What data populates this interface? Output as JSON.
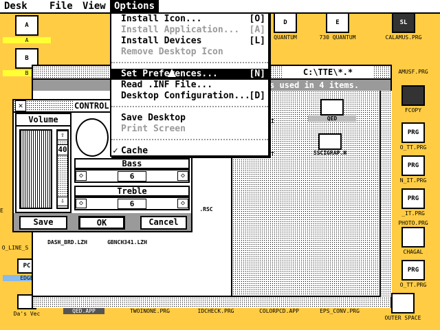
{
  "menubar": {
    "items": [
      "Desk",
      "File",
      "View",
      "Options"
    ]
  },
  "options_menu": {
    "group1": [
      {
        "label": "Install Icon...",
        "key": "[O]",
        "disabled": false
      },
      {
        "label": "Install Application...",
        "key": "[A]",
        "disabled": true
      },
      {
        "label": "Install Devices",
        "key": "[L]",
        "disabled": false
      },
      {
        "label": "Remove Desktop Icon",
        "key": "",
        "disabled": true
      }
    ],
    "group2": [
      {
        "label": "Set Preferences...",
        "key": "[N]",
        "selected": true
      },
      {
        "label": "Read .INF File...",
        "key": ""
      },
      {
        "label": "Desktop Configuration...",
        "key": "[D]"
      }
    ],
    "group3": [
      {
        "label": "Save Desktop",
        "key": "",
        "disabled": false
      },
      {
        "label": "Print Screen",
        "key": "",
        "disabled": true
      }
    ],
    "group4": [
      {
        "check": "✓",
        "label": "Cache"
      }
    ]
  },
  "window_path": {
    "title": "C:\\TTE\\*.*",
    "info": "s used in 4 items."
  },
  "files": [
    {
      "label": "MI"
    },
    {
      "label": "QED"
    },
    {
      "label": "IT"
    },
    {
      "label": "SSCIGRAP.H"
    },
    {
      "label": ".RSC"
    },
    {
      "label": "DASH_BRD.LZH"
    },
    {
      "label": "GBNCH341.LZH"
    }
  ],
  "control_panel": {
    "title": "CONTROL",
    "volume_label": "Volume",
    "volume_value": "40",
    "bass_label": "Bass",
    "bass_value": "6",
    "treble_label": "Treble",
    "treble_value": "6",
    "save": "Save",
    "ok": "OK",
    "cancel": "Cancel"
  },
  "desktop_icons": {
    "left": [
      {
        "label": "A",
        "pic": "A"
      },
      {
        "label": "B",
        "pic": "B"
      },
      {
        "label": "GE",
        "pic": ""
      },
      {
        "label": "O_LINE_S",
        "pic": ""
      },
      {
        "label": "EDGE",
        "pic": "PC"
      },
      {
        "label": "Da's Vec",
        "pic": ""
      }
    ],
    "top": [
      {
        "label": "QUANTUM",
        "pic": "D"
      },
      {
        "label": "730 QUANTUM",
        "pic": "E"
      },
      {
        "label": "CALAMUS.PRG",
        "pic": "SL"
      }
    ],
    "right": [
      {
        "label": "AMUSF.PRG",
        "pic": ""
      },
      {
        "label": "FCOPY",
        "pic": ""
      },
      {
        "label": "O_TT.PRG",
        "pic": "PRG"
      },
      {
        "label": "N_IT.PRG",
        "pic": "PRG"
      },
      {
        "label": "_IT.PRG",
        "pic": "PRG"
      },
      {
        "label": "PHOTO.PRG",
        "pic": "PRG"
      },
      {
        "label": "CHAGAL",
        "pic": ""
      },
      {
        "label": "O_TT.PRG",
        "pic": "PRG"
      }
    ],
    "bottom": [
      {
        "label": "QED.APP",
        "pic": ""
      },
      {
        "label": "TWOINONE.PRG",
        "pic": ""
      },
      {
        "label": "IDCHECK.PRG",
        "pic": ""
      },
      {
        "label": "COLORPCD.APP",
        "pic": ""
      },
      {
        "label": "EPS_CONV.PRG",
        "pic": ""
      },
      {
        "label": "OUTER SPACE",
        "pic": ""
      }
    ]
  }
}
